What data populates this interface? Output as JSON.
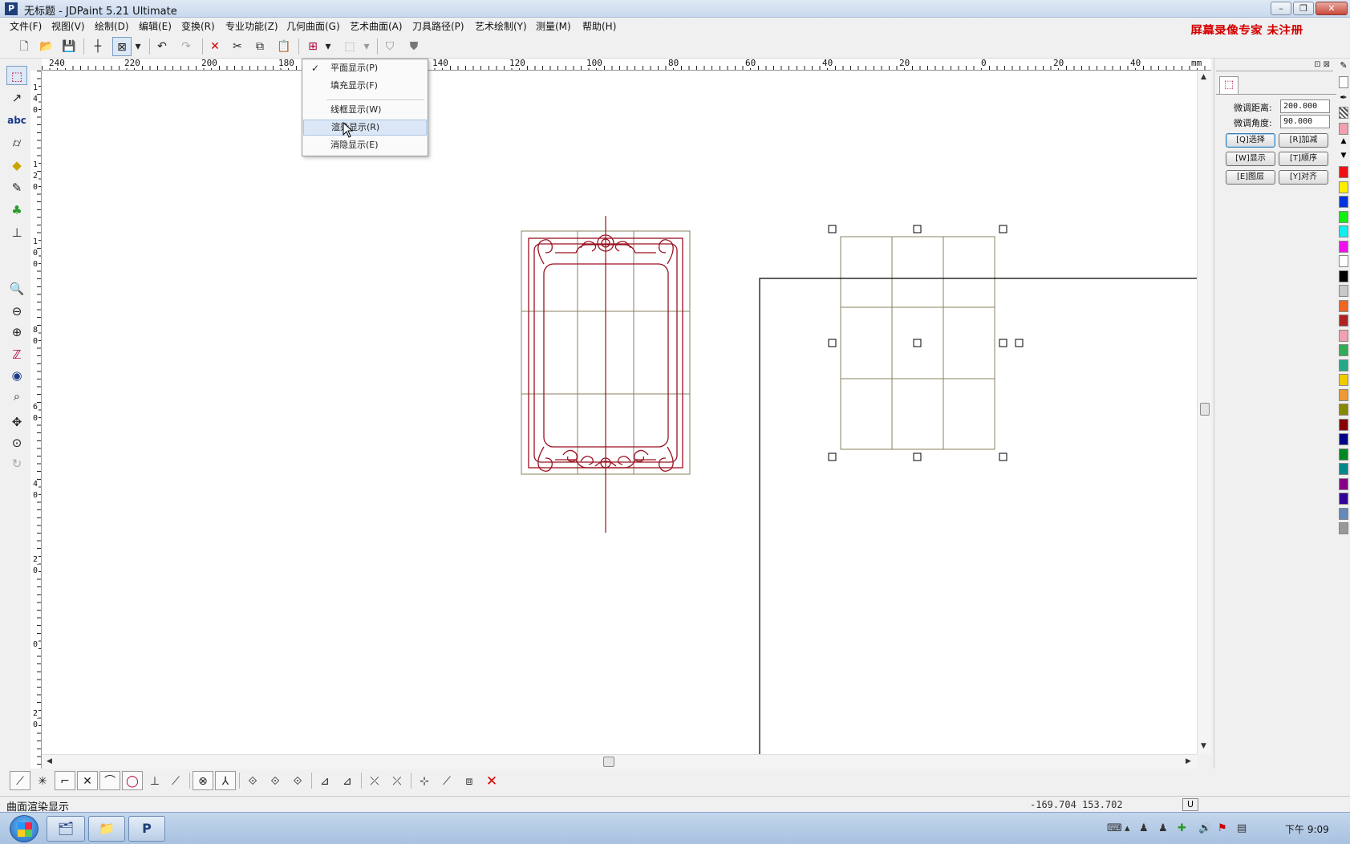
{
  "window": {
    "title": "无标题 - JDPaint 5.21 Ultimate",
    "app_icon": "P",
    "minimize_label": "–",
    "maximize_label": "❐",
    "close_label": "✕"
  },
  "menus": [
    "文件(F)",
    "视图(V)",
    "绘制(D)",
    "编辑(E)",
    "变换(R)",
    "专业功能(Z)",
    "几何曲面(G)",
    "艺术曲面(A)",
    "刀具路径(P)",
    "艺术绘制(Y)",
    "测量(M)",
    "帮助(H)"
  ],
  "watermark": "屏幕录像专家 未注册",
  "ruler": {
    "unit": "mm",
    "h_labels": [
      "240",
      "220",
      "200",
      "180",
      "140",
      "120",
      "100",
      "80",
      "60",
      "40",
      "20",
      "0",
      "20",
      "40"
    ],
    "v_labels": [
      "1",
      "4",
      "0",
      "1",
      "2",
      "0",
      "1",
      "0",
      "0",
      "8",
      "0",
      "6",
      "0",
      "4",
      "0",
      "2",
      "0",
      "0",
      "2",
      "0"
    ]
  },
  "view_menu": {
    "items": [
      {
        "label": "平面显示(P)",
        "checked": true
      },
      {
        "label": "填充显示(F)",
        "checked": false
      },
      {
        "label": "线框显示(W)",
        "checked": false
      },
      {
        "label": "渲染显示(R)",
        "checked": false,
        "highlighted": true
      },
      {
        "label": "消隐显示(E)",
        "checked": false
      }
    ],
    "check_mark": "✓"
  },
  "right_panel": {
    "pin_icons": "⊡ ⊠",
    "tab_icon": "select-node-icon",
    "fine_distance_label": "微调距离:",
    "fine_distance_value": "200.000",
    "fine_angle_label": "微调角度:",
    "fine_angle_value": "90.000",
    "buttons": [
      {
        "label": "[Q]选择",
        "active": true
      },
      {
        "label": "[R]加减",
        "active": false
      },
      {
        "label": "[W]显示",
        "active": false
      },
      {
        "label": "[T]顺序",
        "active": false
      },
      {
        "label": "[E]图层",
        "active": false
      },
      {
        "label": "[Y]对齐",
        "active": false
      }
    ]
  },
  "palette": [
    "#ee1111",
    "#ffee00",
    "#0033dd",
    "#11ee11",
    "#11eeee",
    "#ee11ee",
    "#ffffff",
    "#000000",
    "#c8c8c8",
    "#ee6622",
    "#b02222",
    "#f0a0b0",
    "#33aa55",
    "#22aa88",
    "#eecc00",
    "#ee9933",
    "#888800",
    "#880000",
    "#000088",
    "#008822",
    "#008888",
    "#880088",
    "#330099",
    "#6688bb",
    "#999999"
  ],
  "status": {
    "message": "曲面渲染显示",
    "coords": "-169.704 153.702",
    "mode": "U"
  },
  "taskbar": {
    "clock": "下午 9:09",
    "task_icons": [
      "app-folder-icon",
      "explorer-icon",
      "jdpaint-icon"
    ]
  },
  "colors": {
    "frame_line": "#8a8060",
    "ornament": "#9a1020",
    "axis": "#000000",
    "canvas_bg": "#ffffff"
  }
}
